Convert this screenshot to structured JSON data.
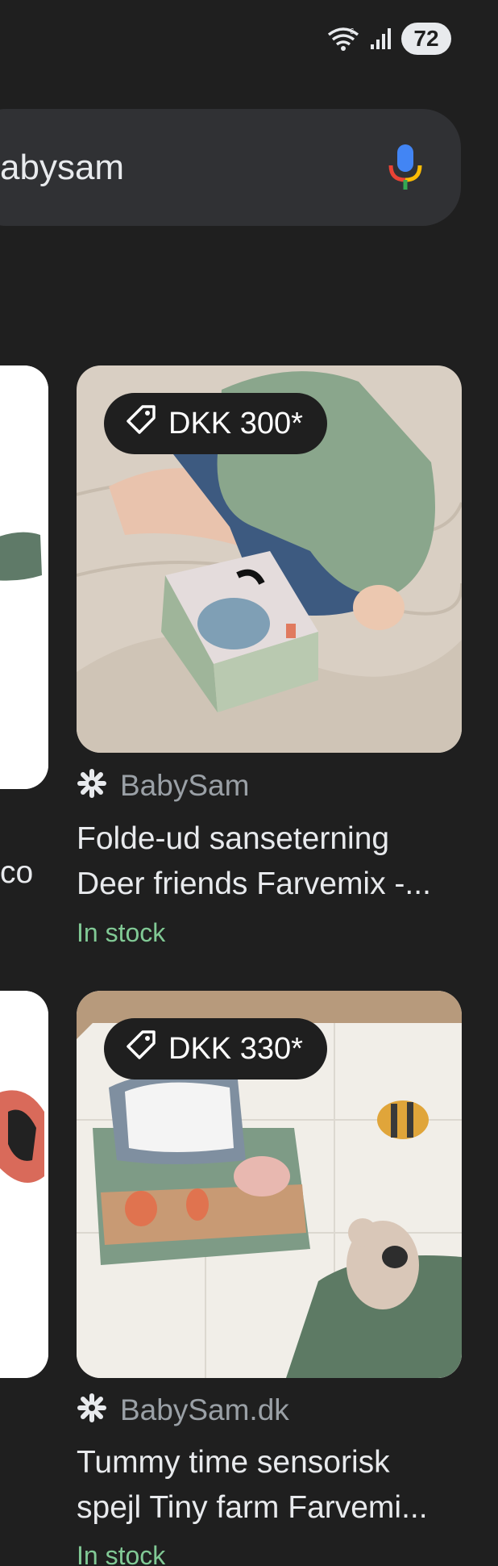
{
  "status_bar": {
    "battery": "72"
  },
  "search": {
    "query": "abysam"
  },
  "products": [
    {
      "price": "DKK 300*",
      "merchant": "BabySam",
      "title_line1": "Folde-ud sanseterning",
      "title_line2": "Deer friends Farvemix -...",
      "stock": "In stock"
    },
    {
      "price": "DKK 330*",
      "merchant": "BabySam.dk",
      "title_line1": "Tummy time sensorisk",
      "title_line2": "spejl Tiny farm Farvemi...",
      "stock": "In stock"
    }
  ],
  "left_column": {
    "partial_text": "co"
  },
  "colors": {
    "background": "#1f1f1f",
    "search_bar": "#303134",
    "stock_green": "#81c995",
    "merchant_gray": "#9aa0a6"
  }
}
